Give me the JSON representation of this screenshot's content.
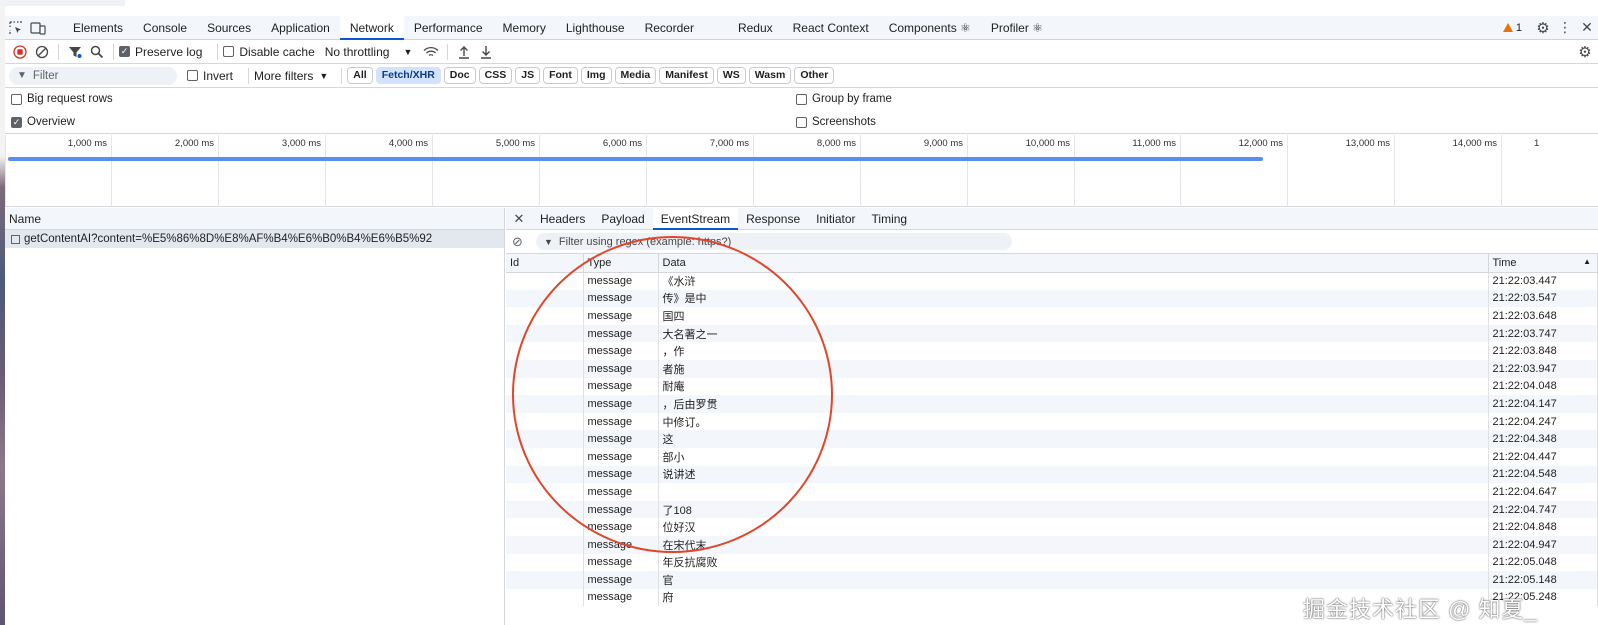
{
  "main_tabs": [
    "Elements",
    "Console",
    "Sources",
    "Application",
    "Network",
    "Performance",
    "Memory",
    "Lighthouse",
    "Recorder",
    "Redux",
    "React Context",
    "Components",
    "Profiler"
  ],
  "active_tab": "Network",
  "components_tab": "Components ⚛",
  "profiler_tab": "Profiler ⚛",
  "warning_count": "1",
  "toolbar": {
    "preserve_log": "Preserve log",
    "disable_cache": "Disable cache",
    "throttling": "No throttling"
  },
  "filter": {
    "placeholder": "Filter",
    "invert": "Invert",
    "more_filters": "More filters",
    "types": [
      "All",
      "Fetch/XHR",
      "Doc",
      "CSS",
      "JS",
      "Font",
      "Img",
      "Media",
      "Manifest",
      "WS",
      "Wasm",
      "Other"
    ],
    "selected_type": "Fetch/XHR"
  },
  "options": {
    "big_request_rows": "Big request rows",
    "overview": "Overview",
    "group_by_frame": "Group by frame",
    "screenshots": "Screenshots"
  },
  "overview_ticks": [
    "1,000 ms",
    "2,000 ms",
    "3,000 ms",
    "4,000 ms",
    "5,000 ms",
    "6,000 ms",
    "7,000 ms",
    "8,000 ms",
    "9,000 ms",
    "10,000 ms",
    "11,000 ms",
    "12,000 ms",
    "13,000 ms",
    "14,000 ms",
    "1"
  ],
  "name_panel": {
    "header": "Name",
    "request": "getContentAI?content=%E5%86%8D%E8%AF%B4%E6%B0%B4%E6%B5%92"
  },
  "detail_tabs": [
    "Headers",
    "Payload",
    "EventStream",
    "Response",
    "Initiator",
    "Timing"
  ],
  "active_detail_tab": "EventStream",
  "regex_placeholder": "Filter using regex (example: https?)",
  "event_table": {
    "headers": {
      "id": "Id",
      "type": "Type",
      "data": "Data",
      "time": "Time"
    },
    "rows": [
      {
        "type": "message",
        "data": "《水浒",
        "time": "21:22:03.447"
      },
      {
        "type": "message",
        "data": "传》是中",
        "time": "21:22:03.547"
      },
      {
        "type": "message",
        "data": "国四",
        "time": "21:22:03.648"
      },
      {
        "type": "message",
        "data": "大名著之一",
        "time": "21:22:03.747"
      },
      {
        "type": "message",
        "data": "，作",
        "time": "21:22:03.848"
      },
      {
        "type": "message",
        "data": "者施",
        "time": "21:22:03.947"
      },
      {
        "type": "message",
        "data": "耐庵",
        "time": "21:22:04.048"
      },
      {
        "type": "message",
        "data": "，后由罗贯",
        "time": "21:22:04.147"
      },
      {
        "type": "message",
        "data": "中修订。",
        "time": "21:22:04.247"
      },
      {
        "type": "message",
        "data": "这",
        "time": "21:22:04.348"
      },
      {
        "type": "message",
        "data": "部小",
        "time": "21:22:04.447"
      },
      {
        "type": "message",
        "data": "说讲述",
        "time": "21:22:04.548"
      },
      {
        "type": "message",
        "data": "",
        "time": "21:22:04.647"
      },
      {
        "type": "message",
        "data": "了108",
        "time": "21:22:04.747"
      },
      {
        "type": "message",
        "data": "位好汉",
        "time": "21:22:04.848"
      },
      {
        "type": "message",
        "data": "在宋代末",
        "time": "21:22:04.947"
      },
      {
        "type": "message",
        "data": "年反抗腐败",
        "time": "21:22:05.048"
      },
      {
        "type": "message",
        "data": "官",
        "time": "21:22:05.148"
      },
      {
        "type": "message",
        "data": "府",
        "time": "21:22:05.248"
      }
    ]
  },
  "watermark": "掘金技术社区 @ 知夏_",
  "colors": {
    "accent": "#0b57d0",
    "overview_bar": "#5b8def",
    "annotation_circle": "#e0462a",
    "warning": "#e8710a"
  }
}
